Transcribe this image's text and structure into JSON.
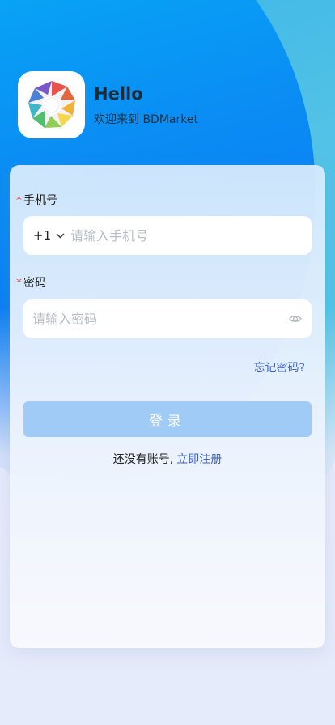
{
  "header": {
    "title": "Hello",
    "subtitle": "欢迎来到 BDMarket"
  },
  "form": {
    "phone_label": "手机号",
    "required_mark": "*",
    "country_code": "+1",
    "phone_placeholder": "请输入手机号",
    "password_label": "密码",
    "password_placeholder": "请输入密码",
    "forgot_password": "忘记密码?",
    "login_button": "登录",
    "no_account_text": "还没有账号,",
    "register_link": "立即注册"
  },
  "colors": {
    "primary_blue": "#0a8cf4",
    "login_button_disabled": "#a0cbf6",
    "link": "#3e63c2",
    "required": "#e2483d"
  },
  "icons": {
    "logo": "geometric-star-logo",
    "country_dropdown": "chevron-down-icon",
    "password_toggle": "eye-icon"
  }
}
